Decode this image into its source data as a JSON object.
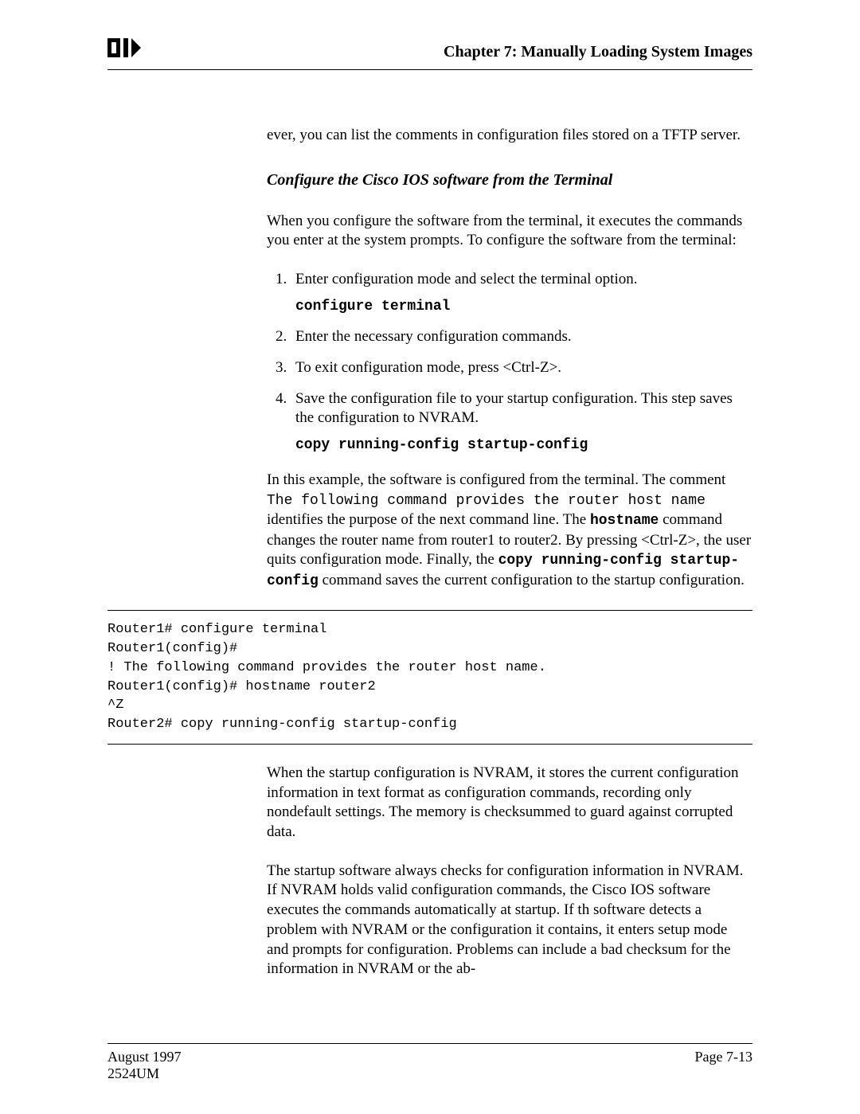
{
  "header": {
    "chapter_title": "Chapter 7: Manually Loading System Images"
  },
  "body": {
    "para_intro": "ever, you can list the comments in configuration files stored on a TFTP server.",
    "subhead": "Configure the Cisco IOS software from the Terminal",
    "para_terminal": "When you configure the software from the terminal, it executes the commands you enter at the system prompts. To configure the software from the terminal:",
    "steps": {
      "s1": "Enter configuration mode and select the terminal option.",
      "s1_cmd": "configure terminal",
      "s2": "Enter the necessary configuration commands.",
      "s3": "To exit configuration mode, press <Ctrl-Z>.",
      "s4": "Save the configuration file to your startup configuration. This step saves the configuration to NVRAM.",
      "s4_cmd": "copy running-config startup-config"
    },
    "example_a": "In this example, the software is configured from the terminal. The comment ",
    "example_mono": "The following command provides the router host name",
    "example_b": " identifies the purpose of the next command line. The ",
    "example_hostname": "hostname",
    "example_c": " command changes the router name from router1 to router2. By pressing <Ctrl-Z>, the user quits configuration mode. Finally, the ",
    "example_copycmd": "copy running-config startup-config",
    "example_d": " command saves the current configuration to the startup configuration.",
    "code": "Router1# configure terminal\nRouter1(config)#\n! The following command provides the router host name.\nRouter1(config)# hostname router2\n^Z\nRouter2# copy running-config startup-config",
    "para_nvram1": "When the startup configuration is NVRAM, it stores the current configuration information in text format as configuration commands, recording only nondefault settings. The memory is checksummed to guard against corrupted data.",
    "para_nvram2": "The startup software always checks for configuration information in NVRAM. If NVRAM holds valid configuration commands, the Cisco IOS software executes the commands automatically at startup. If th software detects a problem with NVRAM or the configuration it contains, it enters setup mode and prompts for configuration. Problems can include a bad checksum for the information in NVRAM or the ab-"
  },
  "footer": {
    "date": "August 1997",
    "doc": "2524UM",
    "page": "Page 7-13"
  }
}
